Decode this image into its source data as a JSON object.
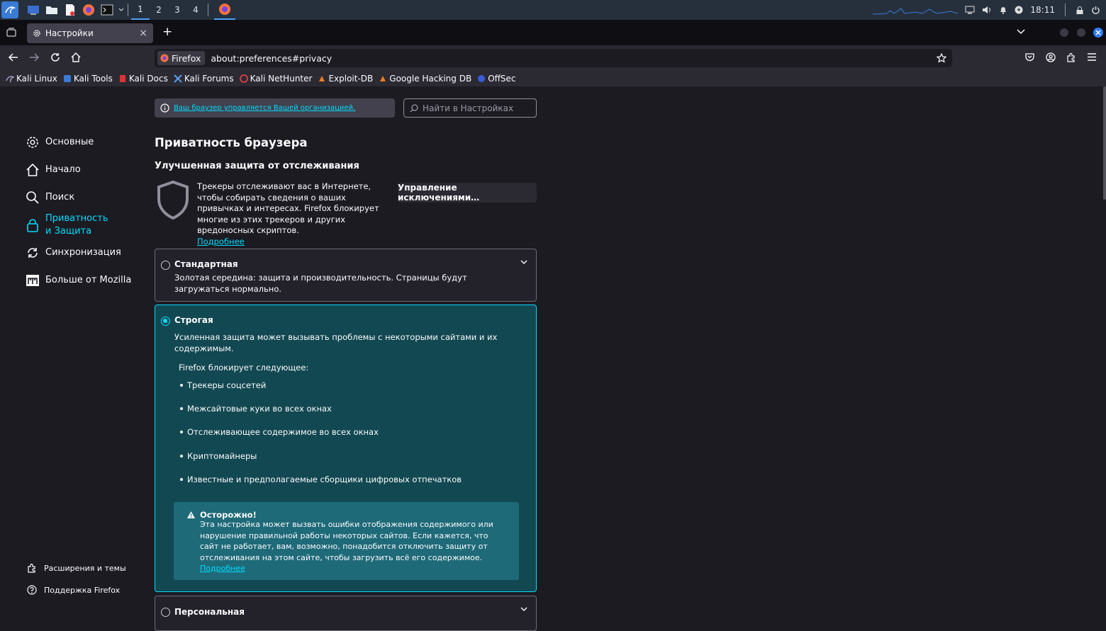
{
  "taskbar": {
    "workspaces": [
      "1",
      "2",
      "3",
      "4"
    ],
    "clock": "18:11"
  },
  "tab": {
    "title": "Настройки",
    "close": "×",
    "new": "+"
  },
  "urlbar": {
    "identity": "Firefox",
    "url": "about:preferences#privacy"
  },
  "bookmarks": [
    {
      "label": "Kali Linux"
    },
    {
      "label": "Kali Tools"
    },
    {
      "label": "Kali Docs"
    },
    {
      "label": "Kali Forums"
    },
    {
      "label": "Kali NetHunter"
    },
    {
      "label": "Exploit-DB"
    },
    {
      "label": "Google Hacking DB"
    },
    {
      "label": "OffSec"
    }
  ],
  "sidebar": {
    "items": [
      {
        "label": "Основные",
        "icon": "gear-icon"
      },
      {
        "label": "Начало",
        "icon": "home-icon"
      },
      {
        "label": "Поиск",
        "icon": "search-icon"
      },
      {
        "label": "Приватность и Защита",
        "icon": "lock-icon"
      },
      {
        "label": "Синхронизация",
        "icon": "sync-icon"
      },
      {
        "label": "Больше от Mozilla",
        "icon": "mozilla-icon"
      }
    ],
    "footer": [
      {
        "label": "Расширения и темы",
        "icon": "extensions-icon"
      },
      {
        "label": "Поддержка Firefox",
        "icon": "help-icon"
      }
    ]
  },
  "policy": "Ваш браузер управляется Вашей организацией.",
  "search_placeholder": "Найти в Настройках",
  "heading": "Приватность браузера",
  "subheading": "Улучшенная защита от отслеживания",
  "tracking": {
    "description": "Трекеры отслеживают вас в Интернете, чтобы собирать сведения о ваших привычках и интересах. Firefox блокирует многие из этих трекеров и других вредоносных скриптов.",
    "learn_more": "Подробнее",
    "exceptions_button": "Управление исключениями…"
  },
  "options": {
    "standard": {
      "title": "Стандартная",
      "desc": "Золотая середина: защита и производительность. Страницы будут загружаться нормально."
    },
    "strict": {
      "title": "Строгая",
      "desc": "Усиленная защита может вызывать проблемы с некоторыми сайтами и их содержимым.",
      "blocks_label": "Firefox блокирует следующее:",
      "blocks": [
        "Трекеры соцсетей",
        "Межсайтовые куки во всех окнах",
        "Отслеживающее содержимое во всех окнах",
        "Криптомайнеры",
        "Известные и предполагаемые сборщики цифровых отпечатков"
      ],
      "warning_title": "Осторожно!",
      "warning_text": "Эта настройка может вызвать ошибки отображения содержимого или нарушение правильной работы некоторых сайтов. Если кажется, что сайт не работает, вам, возможно, понадобится отключить защиту от отслеживания на этом сайте, чтобы загрузить всё его содержимое.",
      "warning_link": "Подробнее"
    },
    "custom": {
      "title": "Персональная"
    }
  },
  "colors": {
    "accent": "#00ddff",
    "selected_bg": "#124851",
    "warning_bg": "#1f6a78"
  }
}
